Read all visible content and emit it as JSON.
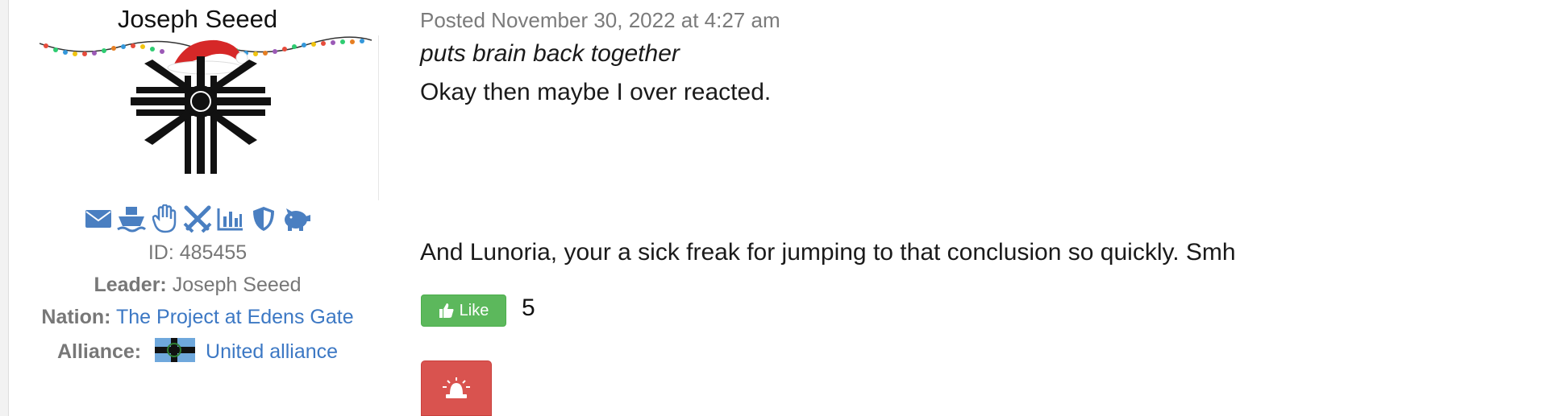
{
  "author": {
    "name": "Joseph Seeed",
    "avatar_alt": "",
    "icons": [
      {
        "name": "envelope-icon"
      },
      {
        "name": "ship-icon"
      },
      {
        "name": "hand-icon"
      },
      {
        "name": "crossed-swords-icon"
      },
      {
        "name": "bar-chart-icon"
      },
      {
        "name": "shield-icon"
      },
      {
        "name": "piggy-bank-icon"
      }
    ],
    "id_label": "ID:",
    "id_value": "485455",
    "leader_label": "Leader:",
    "leader_value": "Joseph Seeed",
    "nation_label": "Nation:",
    "nation_value": "The Project at Edens Gate",
    "alliance_label": "Alliance:",
    "alliance_value": "United alliance"
  },
  "post": {
    "meta": "Posted November 30, 2022 at 4:27 am",
    "lines": [
      "puts brain back together",
      "Okay then maybe I over reacted.",
      "And Lunoria, your a sick freak for jumping to that conclusion so quickly. Smh"
    ],
    "like_label": "Like",
    "like_count": "5"
  },
  "colors": {
    "link": "#3c78c4",
    "like_green": "#5cb85c",
    "report_red": "#d9534f",
    "icon_blue": "#4a7fc1"
  }
}
